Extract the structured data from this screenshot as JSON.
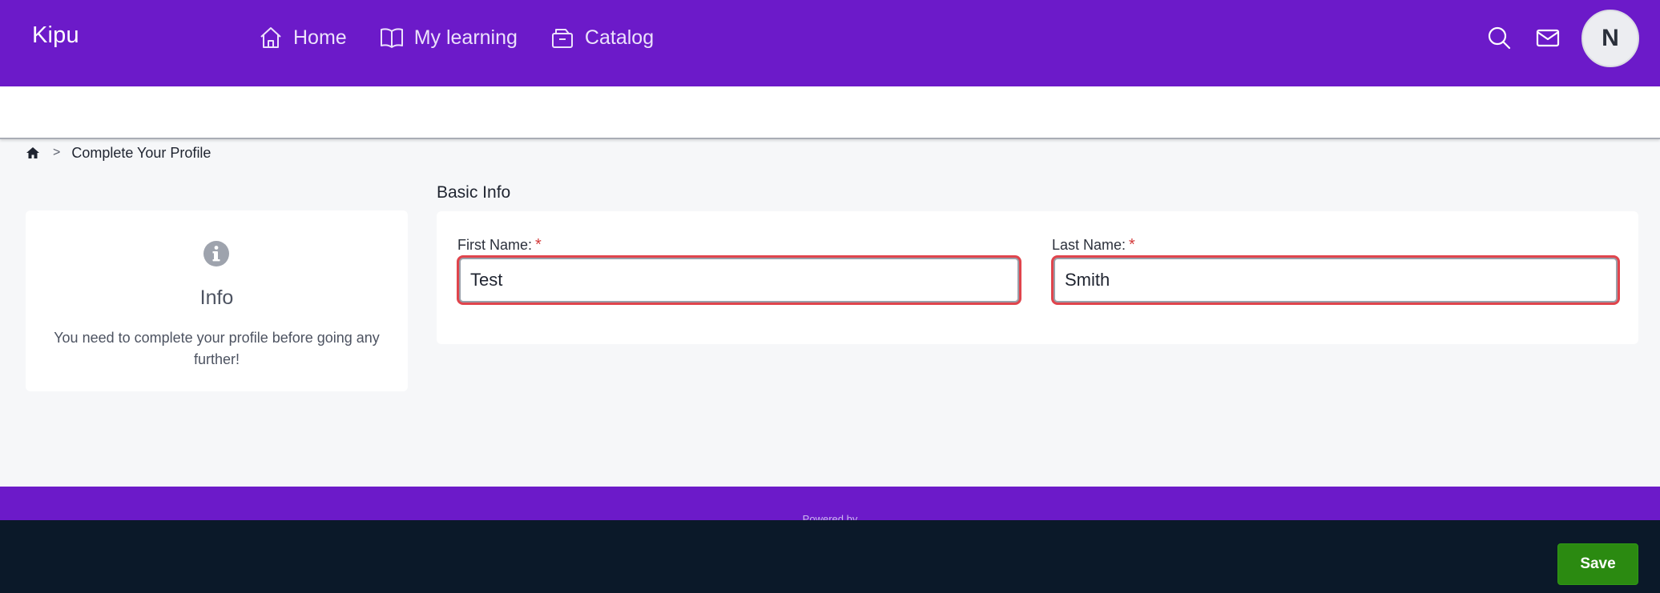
{
  "header": {
    "logo": "Kipu",
    "nav": [
      {
        "label": "Home",
        "icon": "home-icon"
      },
      {
        "label": "My learning",
        "icon": "book-icon"
      },
      {
        "label": "Catalog",
        "icon": "catalog-icon"
      }
    ],
    "avatar_initial": "N",
    "search_icon": "search-icon",
    "mail_icon": "mail-icon"
  },
  "breadcrumb": {
    "home_icon": "home-solid-icon",
    "separator": ">",
    "current": "Complete Your Profile"
  },
  "info_card": {
    "icon": "info-circle-icon",
    "title": "Info",
    "message": "You need to complete your profile before going any further!"
  },
  "basic_info": {
    "title": "Basic Info",
    "first_name": {
      "label": "First Name:",
      "required_mark": "*",
      "value": "Test"
    },
    "last_name": {
      "label": "Last Name:",
      "required_mark": "*",
      "value": "Smith"
    }
  },
  "footer": {
    "powered_by": "Powered by"
  },
  "actions": {
    "save_label": "Save"
  },
  "colors": {
    "brand_purple": "#6c1ac9",
    "action_bar": "#0b1929",
    "save_green": "#2b8a11",
    "error_outline": "#e0444c"
  }
}
